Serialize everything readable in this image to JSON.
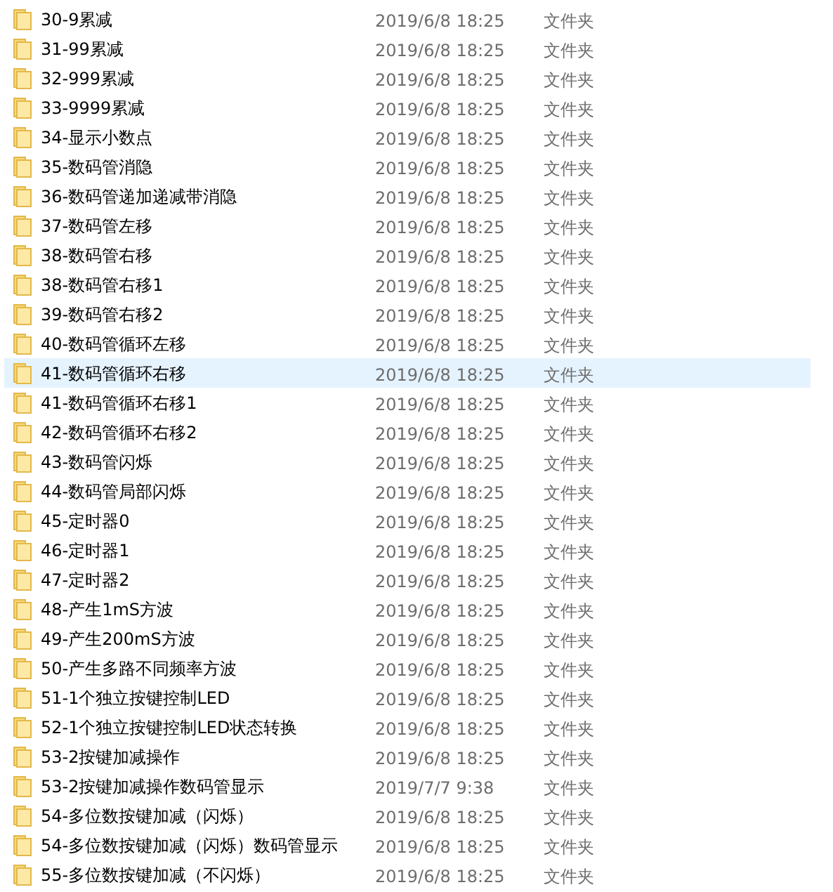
{
  "files": [
    {
      "name": "30-9累减",
      "modified": "2019/6/8 18:25",
      "type": "文件夹",
      "selected": false
    },
    {
      "name": "31-99累减",
      "modified": "2019/6/8 18:25",
      "type": "文件夹",
      "selected": false
    },
    {
      "name": "32-999累减",
      "modified": "2019/6/8 18:25",
      "type": "文件夹",
      "selected": false
    },
    {
      "name": "33-9999累减",
      "modified": "2019/6/8 18:25",
      "type": "文件夹",
      "selected": false
    },
    {
      "name": "34-显示小数点",
      "modified": "2019/6/8 18:25",
      "type": "文件夹",
      "selected": false
    },
    {
      "name": "35-数码管消隐",
      "modified": "2019/6/8 18:25",
      "type": "文件夹",
      "selected": false
    },
    {
      "name": "36-数码管递加递减带消隐",
      "modified": "2019/6/8 18:25",
      "type": "文件夹",
      "selected": false
    },
    {
      "name": "37-数码管左移",
      "modified": "2019/6/8 18:25",
      "type": "文件夹",
      "selected": false
    },
    {
      "name": "38-数码管右移",
      "modified": "2019/6/8 18:25",
      "type": "文件夹",
      "selected": false
    },
    {
      "name": "38-数码管右移1",
      "modified": "2019/6/8 18:25",
      "type": "文件夹",
      "selected": false
    },
    {
      "name": "39-数码管右移2",
      "modified": "2019/6/8 18:25",
      "type": "文件夹",
      "selected": false
    },
    {
      "name": "40-数码管循环左移",
      "modified": "2019/6/8 18:25",
      "type": "文件夹",
      "selected": false
    },
    {
      "name": "41-数码管循环右移",
      "modified": "2019/6/8 18:25",
      "type": "文件夹",
      "selected": true
    },
    {
      "name": "41-数码管循环右移1",
      "modified": "2019/6/8 18:25",
      "type": "文件夹",
      "selected": false
    },
    {
      "name": "42-数码管循环右移2",
      "modified": "2019/6/8 18:25",
      "type": "文件夹",
      "selected": false
    },
    {
      "name": "43-数码管闪烁",
      "modified": "2019/6/8 18:25",
      "type": "文件夹",
      "selected": false
    },
    {
      "name": "44-数码管局部闪烁",
      "modified": "2019/6/8 18:25",
      "type": "文件夹",
      "selected": false
    },
    {
      "name": "45-定时器0",
      "modified": "2019/6/8 18:25",
      "type": "文件夹",
      "selected": false
    },
    {
      "name": "46-定时器1",
      "modified": "2019/6/8 18:25",
      "type": "文件夹",
      "selected": false
    },
    {
      "name": "47-定时器2",
      "modified": "2019/6/8 18:25",
      "type": "文件夹",
      "selected": false
    },
    {
      "name": "48-产生1mS方波",
      "modified": "2019/6/8 18:25",
      "type": "文件夹",
      "selected": false
    },
    {
      "name": "49-产生200mS方波",
      "modified": "2019/6/8 18:25",
      "type": "文件夹",
      "selected": false
    },
    {
      "name": "50-产生多路不同频率方波",
      "modified": "2019/6/8 18:25",
      "type": "文件夹",
      "selected": false
    },
    {
      "name": "51-1个独立按键控制LED",
      "modified": "2019/6/8 18:25",
      "type": "文件夹",
      "selected": false
    },
    {
      "name": "52-1个独立按键控制LED状态转换",
      "modified": "2019/6/8 18:25",
      "type": "文件夹",
      "selected": false
    },
    {
      "name": "53-2按键加减操作",
      "modified": "2019/6/8 18:25",
      "type": "文件夹",
      "selected": false
    },
    {
      "name": "53-2按键加减操作数码管显示",
      "modified": "2019/7/7 9:38",
      "type": "文件夹",
      "selected": false
    },
    {
      "name": "54-多位数按键加减（闪烁）",
      "modified": "2019/6/8 18:25",
      "type": "文件夹",
      "selected": false
    },
    {
      "name": "54-多位数按键加减（闪烁）数码管显示",
      "modified": "2019/6/8 18:25",
      "type": "文件夹",
      "selected": false
    },
    {
      "name": "55-多位数按键加减（不闪烁）",
      "modified": "2019/6/8 18:25",
      "type": "文件夹",
      "selected": false
    }
  ]
}
